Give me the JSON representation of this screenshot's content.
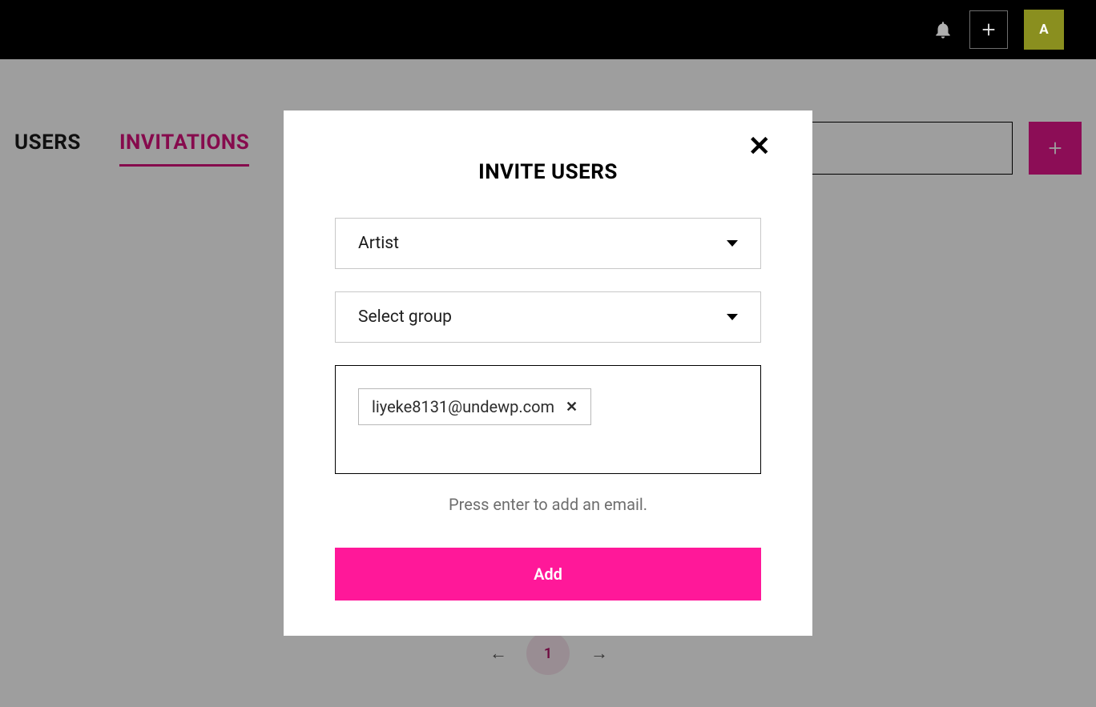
{
  "header": {
    "avatar_initial": "A"
  },
  "tabs": {
    "users": "USERS",
    "invitations": "INVITATIONS"
  },
  "toolbar": {
    "search_placeholder": ""
  },
  "pagination": {
    "current": "1"
  },
  "modal": {
    "title": "INVITE USERS",
    "role_select": "Artist",
    "group_select": "Select group",
    "emails": [
      "liyeke8131@undewp.com"
    ],
    "hint": "Press enter to add an email.",
    "add_button": "Add"
  }
}
